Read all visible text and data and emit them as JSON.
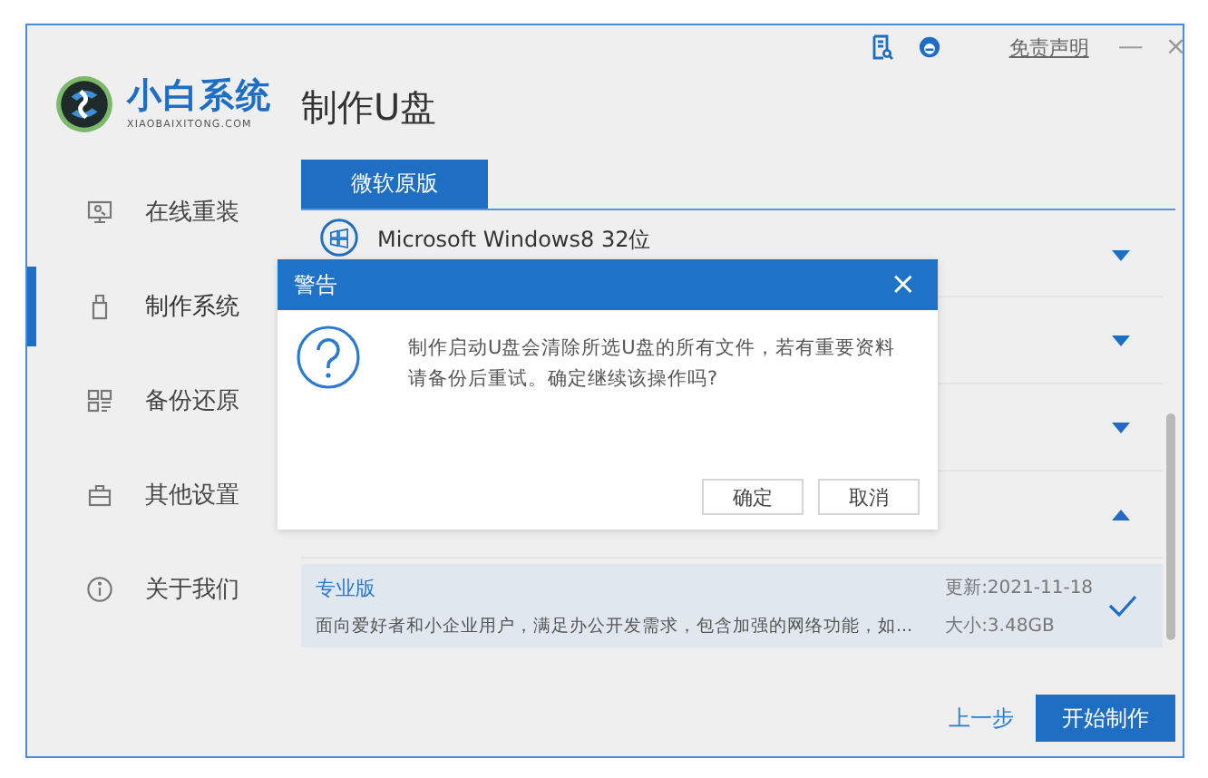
{
  "app": {
    "name": "小白系统",
    "domain": "XIAOBAIXITONG.COM"
  },
  "top_bar": {
    "disclaimer": "免责声明",
    "minimize": "—",
    "close": "×"
  },
  "sidebar": {
    "items": [
      {
        "label": "在线重装",
        "selected": false
      },
      {
        "label": "制作系统",
        "selected": true
      },
      {
        "label": "备份还原",
        "selected": false
      },
      {
        "label": "其他设置",
        "selected": false
      },
      {
        "label": "关于我们",
        "selected": false
      }
    ]
  },
  "page_title": "制作U盘",
  "tabs": [
    {
      "label": "微软原版",
      "selected": true
    }
  ],
  "os_list": [
    {
      "name": "Microsoft Windows8 32位",
      "expanded": false
    },
    {
      "expanded": false
    },
    {
      "expanded": false
    },
    {
      "expanded": true
    }
  ],
  "editions": [
    {
      "name": "专业版",
      "description": "面向爱好者和小企业用户，满足办公开发需求，包含加强的网络功能，如...",
      "updated": "更新:2021-11-18",
      "size": "大小:3.48GB",
      "selected": true
    }
  ],
  "back_link": "上一步",
  "start_button": "开始制作",
  "dialog": {
    "title": "警告",
    "close": "×",
    "message": "制作启动U盘会清除所选U盘的所有文件，若有重要资料请备份后重试。确定继续该操作吗?",
    "buttons": [
      "确定",
      "取消"
    ]
  }
}
